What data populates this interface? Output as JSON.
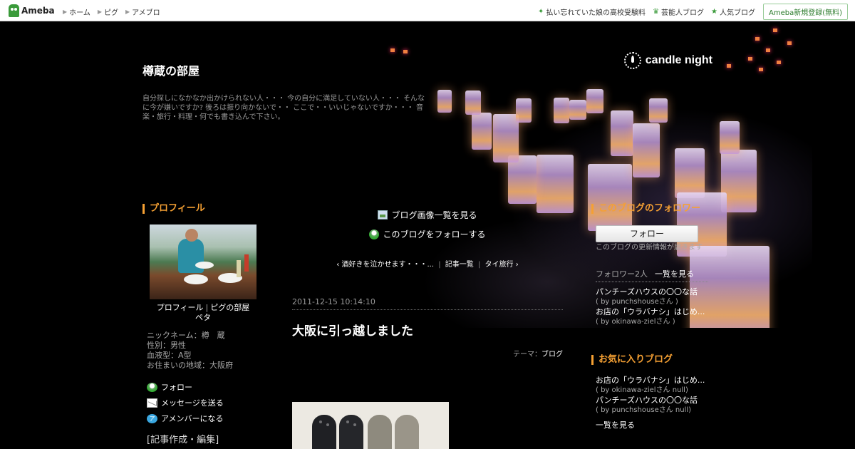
{
  "topbar": {
    "logo": "Ameba",
    "nav_left": [
      "ホーム",
      "ピグ",
      "アメブロ"
    ],
    "nav_right": [
      "払い忘れていた娘の高校受験料",
      "芸能人ブログ",
      "人気ブログ"
    ],
    "register": "Ameba新規登録(無料)"
  },
  "header": {
    "logo_text": "candle night",
    "title": "樽蔵の部屋",
    "description": "自分探しになかなか出かけられない人・・・ 今の自分に満足していない人・・・ そんなに今が嫌いですか? 後ろは振り向かないで・・ ここで・・いいじゃないですか・・・ 音楽・旅行・料理・何でも書き込んで下さい。"
  },
  "profile": {
    "heading": "プロフィール",
    "link_profile": "プロフィール",
    "link_pigg": "ピグの部屋",
    "link_sep": "|",
    "sub_caption": "ペタ",
    "info": [
      "ニックネーム：樽　蔵",
      "性別：男性",
      "血液型：A型",
      "お住まいの地域：大阪府"
    ],
    "actions": [
      "フォロー",
      "メッセージを送る",
      "アメンバーになる"
    ],
    "edit_heading": "[記事作成・編集]"
  },
  "center": {
    "image_list": "ブログ画像一覧を見る",
    "follow_blog": "このブログをフォローする",
    "nav_prev": "酒好きを泣かせます・・・...",
    "nav_list": "記事一覧",
    "nav_theme": "タイ旅行",
    "nav_sep": "|"
  },
  "post": {
    "date": "2011-12-15 10:14:10",
    "title": "大阪に引っ越しました",
    "theme_label": "テーマ：",
    "theme_value": "ブログ"
  },
  "followers": {
    "heading": "このブログのフォロワー",
    "button": "フォロー",
    "note": "このブログの更新情報が届きます",
    "count_label": "フォロワー2人",
    "view_all": "一覧を見る",
    "items": [
      {
        "title": "パンチーズハウスの〇〇な話",
        "by": "( by punchshouseさん )"
      },
      {
        "title": "お店の「ウラバナシ」はじめ...",
        "by": "( by okinawa-zielさん )"
      }
    ]
  },
  "favorites": {
    "heading": "お気に入りブログ",
    "items": [
      {
        "title": "お店の「ウラバナシ」はじめ...",
        "by": "( by okinawa-zielさん null)"
      },
      {
        "title": "パンチーズハウスの〇〇な話",
        "by": "( by punchshouseさん null)"
      }
    ],
    "view_all": "一覧を見る"
  },
  "colors": {
    "accent": "#f5a033",
    "background": "#000000",
    "brand_green": "#3a9a3a"
  }
}
